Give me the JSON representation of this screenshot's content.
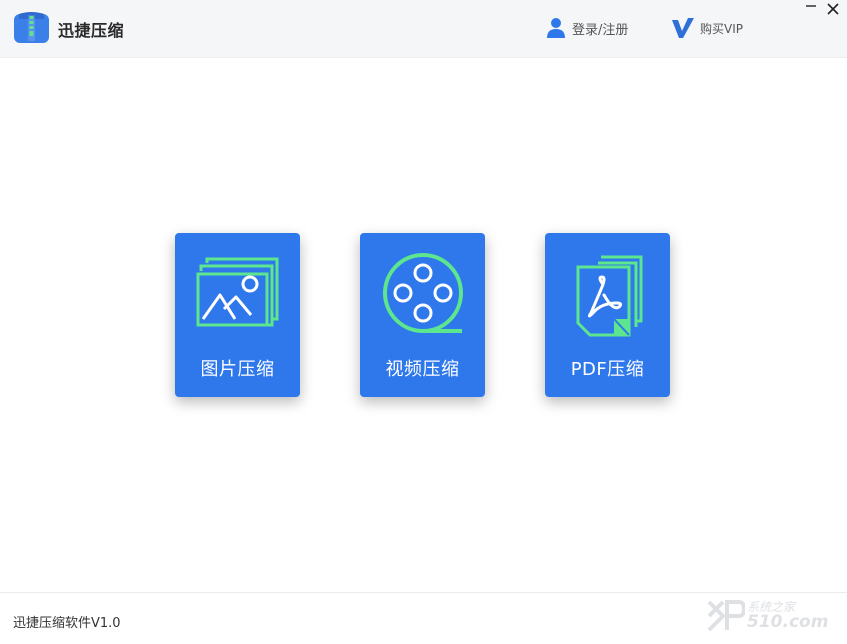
{
  "app": {
    "title": "迅捷压缩",
    "accent": "#2f78ec",
    "icon_accent": "#5ee68f"
  },
  "header": {
    "login_label": "登录/注册",
    "vip_label": "购买VIP"
  },
  "window_controls": {
    "minimize": "—",
    "close": "✕"
  },
  "tools": [
    {
      "label": "图片压缩",
      "icon": "image-icon"
    },
    {
      "label": "视频压缩",
      "icon": "film-reel-icon"
    },
    {
      "label": "PDF压缩",
      "icon": "pdf-icon"
    }
  ],
  "footer": {
    "version": "迅捷压缩软件V1.0"
  },
  "watermark": {
    "brand": "系统之家",
    "site": "510.com"
  }
}
